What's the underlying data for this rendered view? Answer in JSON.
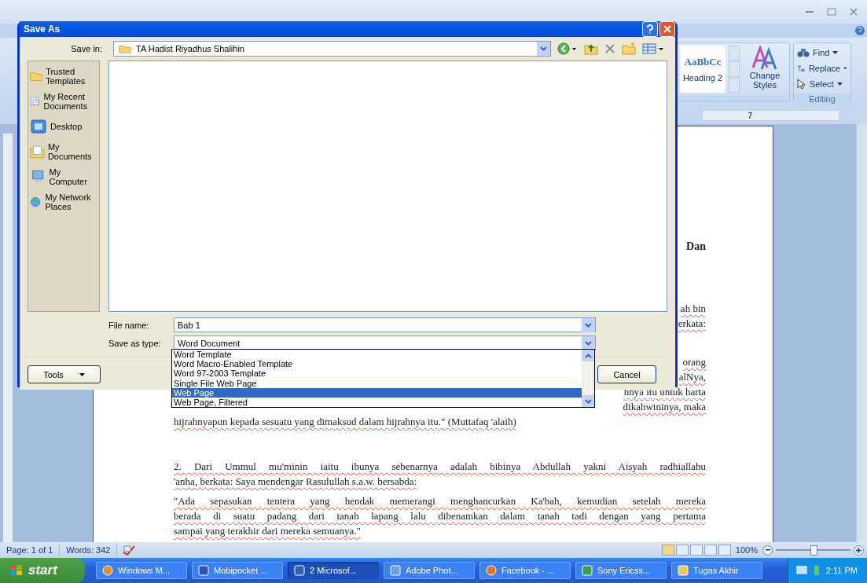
{
  "ribbon": {
    "styles": [
      {
        "sample": "AaBbCc",
        "name": "Heading 2"
      }
    ],
    "change_styles": "Change Styles",
    "editing": {
      "items": [
        {
          "kind": "find",
          "label": "Find"
        },
        {
          "kind": "replace",
          "label": "Replace"
        },
        {
          "kind": "select",
          "label": "Select"
        }
      ],
      "title": "Editing"
    }
  },
  "ruler": {
    "mark": "7"
  },
  "document": {
    "blocks": [
      {
        "kind": "heading",
        "lines": [
          {
            "kind": "cut",
            "text": "Dan"
          }
        ]
      },
      {
        "kind": "paragraph",
        "lines": [
          {
            "kind": "cut",
            "text": "ah bin"
          },
          {
            "kind": "cut",
            "text": "erkata:"
          }
        ]
      },
      {
        "kind": "paragraph",
        "lines": [
          {
            "kind": "cut",
            "text": "orang"
          },
          {
            "kind": "cut",
            "text": "alNya,"
          },
          {
            "kind": "cut",
            "text": "hnya itu untuk harta"
          },
          {
            "kind": "cut",
            "text": "dikahwininya, maka"
          },
          {
            "kind": "end",
            "text": "hijrahnyapun kepada sesuatu yang dimaksud dalam hijrahnya itu.\" (Muttafaq 'alaih)"
          }
        ]
      },
      {
        "kind": "paragraph",
        "lines": [
          {
            "kind": "full",
            "text": "2. Dari Ummul mu'minin iaitu ibunya sebenarnya adalah bibinya Abdullah yakni Aisyah radhiallahu"
          },
          {
            "kind": "end",
            "text": "'anha, berkata: Saya mendengar Rasulullah s.a.w. bersabda:"
          }
        ]
      },
      {
        "kind": "paragraph",
        "lines": [
          {
            "kind": "full",
            "text": "\"Ada sepasukan tentera yang hendak memerangi menghancurkan Ka'bah, kemudian setelah mereka"
          },
          {
            "kind": "full",
            "text": "berada di suatu padang dari tanah lapang lalu dibenamkan dalam tanah tadi dengan yang pertama"
          },
          {
            "kind": "end",
            "text": "sampai yang terakhir dari mereka semuanya.\""
          }
        ]
      }
    ]
  },
  "status_bar": {
    "page": "Page: 1 of 1",
    "words": "Words: 342",
    "zoom": {
      "label": "100%",
      "level": 0.5
    }
  },
  "dialog": {
    "title": "Save As",
    "save_in": {
      "label": "Save in:",
      "value": "TA Hadist Riyadhus Shalihin"
    },
    "places": [
      {
        "kind": "folder",
        "label": "Trusted Templates"
      },
      {
        "kind": "recent",
        "label": "My Recent Documents"
      },
      {
        "kind": "desktop",
        "label": "Desktop"
      },
      {
        "kind": "documents",
        "label": "My Documents"
      },
      {
        "kind": "computer",
        "label": "My Computer"
      },
      {
        "kind": "network",
        "label": "My Network Places"
      }
    ],
    "file_name": {
      "label": "File name:",
      "value": "Bab 1"
    },
    "save_as_type": {
      "label": "Save as type:",
      "value": "Word Document",
      "options": [
        {
          "label": "Word Template",
          "selected": false
        },
        {
          "label": "Word Macro-Enabled Template",
          "selected": false
        },
        {
          "label": "Word 97-2003 Template",
          "selected": false
        },
        {
          "label": "Single File Web Page",
          "selected": false
        },
        {
          "label": "Web Page",
          "selected": true
        },
        {
          "label": "Web Page, Filtered",
          "selected": false
        }
      ]
    },
    "buttons": {
      "tools": "Tools",
      "cancel": "Cancel"
    }
  },
  "taskbar": {
    "start": "start",
    "items": [
      {
        "label": "Windows M...",
        "kind": "media",
        "selected": false
      },
      {
        "label": "Mobipocket ...",
        "kind": "book",
        "selected": false
      },
      {
        "label": "2 Microsof...",
        "kind": "word",
        "selected": true
      },
      {
        "label": "Adobe Phot...",
        "kind": "camera",
        "selected": false
      },
      {
        "label": "Facebook - ...",
        "kind": "firefox",
        "selected": false
      },
      {
        "label": "Sony Ericss...",
        "kind": "phone",
        "selected": false
      },
      {
        "label": "Tugas Akhir",
        "kind": "folder",
        "selected": false
      }
    ],
    "clock": "2:11 PM"
  }
}
